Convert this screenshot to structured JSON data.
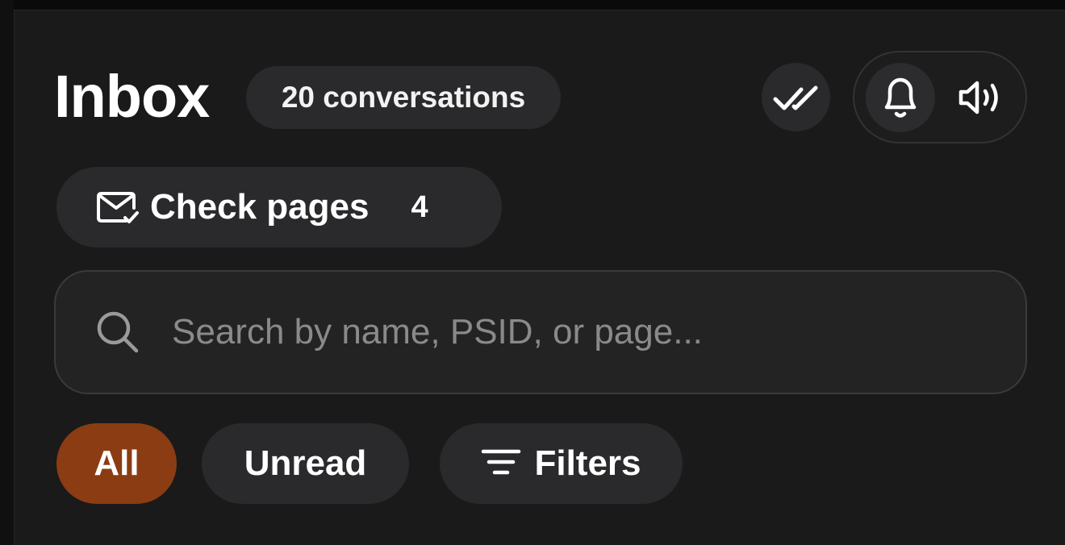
{
  "header": {
    "title": "Inbox",
    "conversation_badge": "20 conversations"
  },
  "actions": {
    "mark_all_read_icon": "double-check-icon",
    "notifications_icon": "bell-icon",
    "sound_icon": "speaker-icon"
  },
  "check_pages": {
    "label": "Check pages",
    "count": "4",
    "icon": "mail-check-icon"
  },
  "search": {
    "placeholder": "Search by name, PSID, or page...",
    "value": "",
    "icon": "search-icon"
  },
  "filters": {
    "chips": [
      {
        "label": "All",
        "active": true
      },
      {
        "label": "Unread",
        "active": false
      },
      {
        "label": "Filters",
        "active": false,
        "icon": "filter-lines-icon"
      }
    ]
  },
  "colors": {
    "background": "#1a1a1a",
    "surface": "#2a2a2c",
    "accent": "#8b3c12",
    "text": "#ffffff",
    "muted_text": "#8a8a8a"
  }
}
